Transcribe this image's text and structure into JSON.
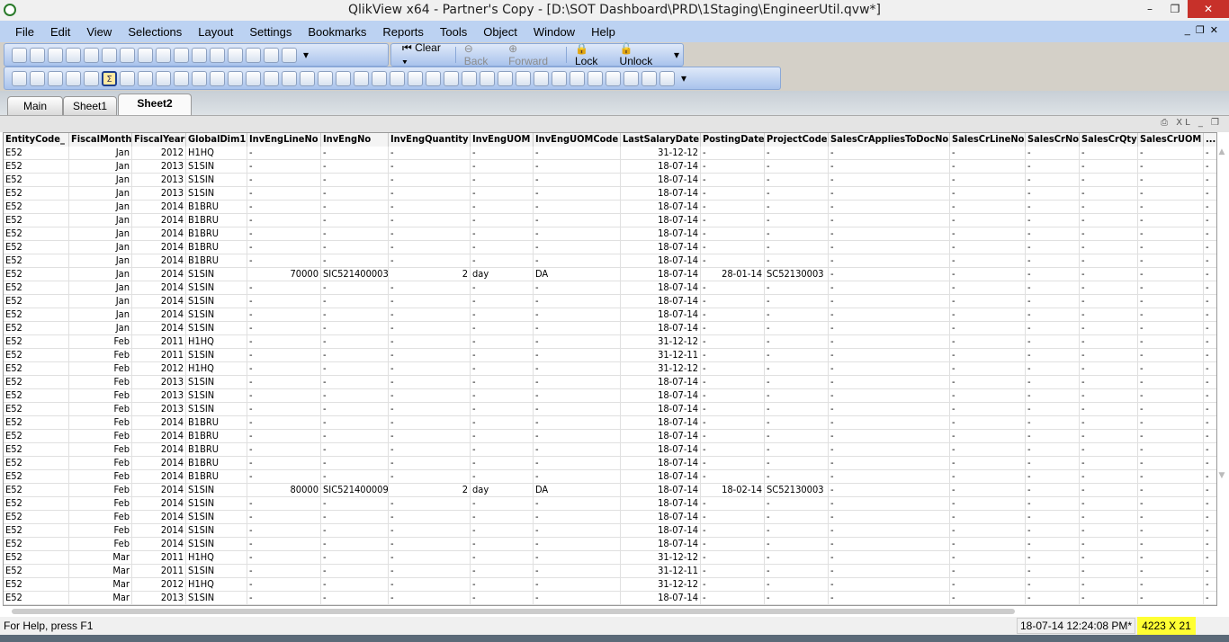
{
  "window": {
    "title": "QlikView x64 - Partner's Copy - [D:\\SOT Dashboard\\PRD\\1Staging\\EngineerUtil.qvw*]",
    "minimize": "–",
    "restore": "❐",
    "close": "✕"
  },
  "menu": [
    "File",
    "Edit",
    "View",
    "Selections",
    "Layout",
    "Settings",
    "Bookmarks",
    "Reports",
    "Tools",
    "Object",
    "Window",
    "Help"
  ],
  "toolbar1": {
    "icons": [
      "new-icon",
      "open-icon",
      "reload-icon",
      "save-icon",
      "print-icon",
      "edit-script-icon",
      "reload-data-icon",
      "undo-icon",
      "redo-icon",
      "search-icon",
      "select-icon",
      "chart-icon",
      "bookmark-star-icon",
      "properties-icon",
      "help-icon",
      "context-help-icon"
    ]
  },
  "nav": {
    "clear": "Clear",
    "back": "Back",
    "forward": "Forward",
    "lock": "Lock",
    "unlock": "Unlock"
  },
  "toolbar2": {
    "icons": [
      "new-sheet-icon",
      "promote-icon",
      "demote-icon",
      "sheet-props-icon",
      "listbox-icon",
      "statistics-box-icon",
      "multibox-icon",
      "table-box-icon",
      "chart-icon",
      "input-box-icon",
      "current-selections-icon",
      "button-icon",
      "text-object-icon",
      "line-arrow-icon",
      "slider-icon",
      "bookmark-object-icon",
      "search-object-icon",
      "container-icon",
      "custom-object-icon",
      "wizard-icon",
      "format-painter-icon",
      "grid-icon",
      "align-left-icon",
      "align-center-icon",
      "align-right-icon",
      "align-bottom-icon",
      "align-middle-icon",
      "align-top-icon",
      "space-vertical-icon",
      "space-horizontal-icon",
      "adjust-left-icon",
      "adjust-top-icon",
      "users-icon",
      "sheet-object-icon",
      "edit-object-icon",
      "link-icon",
      "document-web-icon"
    ]
  },
  "tabs": [
    {
      "label": "Main"
    },
    {
      "label": "Sheet1"
    },
    {
      "label": "Sheet2",
      "active": true
    }
  ],
  "object_caption": {
    "controls": "⎙ XL _ ❐"
  },
  "table": {
    "columns": [
      "EntityCode_",
      "FiscalMonth",
      "FiscalYear",
      "GlobalDim1",
      "InvEngLineNo",
      "InvEngNo",
      "InvEngQuantity",
      "InvEngUOM",
      "InvEngUOMCode",
      "LastSalaryDate",
      "PostingDate",
      "ProjectCode",
      "SalesCrAppliesToDocNo",
      "SalesCrLineNo",
      "SalesCrNo",
      "SalesCrQty",
      "SalesCrUOM",
      "..."
    ],
    "rows": [
      [
        "E52",
        "Jan",
        "2012",
        "H1HQ",
        "-",
        "-",
        "-",
        "-",
        "-",
        "31-12-12",
        "-",
        "-",
        "-",
        "-",
        "-",
        "-",
        "-",
        "-"
      ],
      [
        "E52",
        "Jan",
        "2013",
        "S1SIN",
        "-",
        "-",
        "-",
        "-",
        "-",
        "18-07-14",
        "-",
        "-",
        "-",
        "-",
        "-",
        "-",
        "-",
        "-"
      ],
      [
        "E52",
        "Jan",
        "2013",
        "S1SIN",
        "-",
        "-",
        "-",
        "-",
        "-",
        "18-07-14",
        "-",
        "-",
        "-",
        "-",
        "-",
        "-",
        "-",
        "-"
      ],
      [
        "E52",
        "Jan",
        "2013",
        "S1SIN",
        "-",
        "-",
        "-",
        "-",
        "-",
        "18-07-14",
        "-",
        "-",
        "-",
        "-",
        "-",
        "-",
        "-",
        "-"
      ],
      [
        "E52",
        "Jan",
        "2014",
        "B1BRU",
        "-",
        "-",
        "-",
        "-",
        "-",
        "18-07-14",
        "-",
        "-",
        "-",
        "-",
        "-",
        "-",
        "-",
        "-"
      ],
      [
        "E52",
        "Jan",
        "2014",
        "B1BRU",
        "-",
        "-",
        "-",
        "-",
        "-",
        "18-07-14",
        "-",
        "-",
        "-",
        "-",
        "-",
        "-",
        "-",
        "-"
      ],
      [
        "E52",
        "Jan",
        "2014",
        "B1BRU",
        "-",
        "-",
        "-",
        "-",
        "-",
        "18-07-14",
        "-",
        "-",
        "-",
        "-",
        "-",
        "-",
        "-",
        "-"
      ],
      [
        "E52",
        "Jan",
        "2014",
        "B1BRU",
        "-",
        "-",
        "-",
        "-",
        "-",
        "18-07-14",
        "-",
        "-",
        "-",
        "-",
        "-",
        "-",
        "-",
        "-"
      ],
      [
        "E52",
        "Jan",
        "2014",
        "B1BRU",
        "-",
        "-",
        "-",
        "-",
        "-",
        "18-07-14",
        "-",
        "-",
        "-",
        "-",
        "-",
        "-",
        "-",
        "-"
      ],
      [
        "E52",
        "Jan",
        "2014",
        "S1SIN",
        "70000",
        "SIC521400003",
        "2",
        "day",
        "DA",
        "18-07-14",
        "28-01-14",
        "SC52130003",
        "-",
        "-",
        "-",
        "-",
        "-",
        "-"
      ],
      [
        "E52",
        "Jan",
        "2014",
        "S1SIN",
        "-",
        "-",
        "-",
        "-",
        "-",
        "18-07-14",
        "-",
        "-",
        "-",
        "-",
        "-",
        "-",
        "-",
        "-"
      ],
      [
        "E52",
        "Jan",
        "2014",
        "S1SIN",
        "-",
        "-",
        "-",
        "-",
        "-",
        "18-07-14",
        "-",
        "-",
        "-",
        "-",
        "-",
        "-",
        "-",
        "-"
      ],
      [
        "E52",
        "Jan",
        "2014",
        "S1SIN",
        "-",
        "-",
        "-",
        "-",
        "-",
        "18-07-14",
        "-",
        "-",
        "-",
        "-",
        "-",
        "-",
        "-",
        "-"
      ],
      [
        "E52",
        "Jan",
        "2014",
        "S1SIN",
        "-",
        "-",
        "-",
        "-",
        "-",
        "18-07-14",
        "-",
        "-",
        "-",
        "-",
        "-",
        "-",
        "-",
        "-"
      ],
      [
        "E52",
        "Feb",
        "2011",
        "H1HQ",
        "-",
        "-",
        "-",
        "-",
        "-",
        "31-12-12",
        "-",
        "-",
        "-",
        "-",
        "-",
        "-",
        "-",
        "-"
      ],
      [
        "E52",
        "Feb",
        "2011",
        "S1SIN",
        "-",
        "-",
        "-",
        "-",
        "-",
        "31-12-11",
        "-",
        "-",
        "-",
        "-",
        "-",
        "-",
        "-",
        "-"
      ],
      [
        "E52",
        "Feb",
        "2012",
        "H1HQ",
        "-",
        "-",
        "-",
        "-",
        "-",
        "31-12-12",
        "-",
        "-",
        "-",
        "-",
        "-",
        "-",
        "-",
        "-"
      ],
      [
        "E52",
        "Feb",
        "2013",
        "S1SIN",
        "-",
        "-",
        "-",
        "-",
        "-",
        "18-07-14",
        "-",
        "-",
        "-",
        "-",
        "-",
        "-",
        "-",
        "-"
      ],
      [
        "E52",
        "Feb",
        "2013",
        "S1SIN",
        "-",
        "-",
        "-",
        "-",
        "-",
        "18-07-14",
        "-",
        "-",
        "-",
        "-",
        "-",
        "-",
        "-",
        "-"
      ],
      [
        "E52",
        "Feb",
        "2013",
        "S1SIN",
        "-",
        "-",
        "-",
        "-",
        "-",
        "18-07-14",
        "-",
        "-",
        "-",
        "-",
        "-",
        "-",
        "-",
        "-"
      ],
      [
        "E52",
        "Feb",
        "2014",
        "B1BRU",
        "-",
        "-",
        "-",
        "-",
        "-",
        "18-07-14",
        "-",
        "-",
        "-",
        "-",
        "-",
        "-",
        "-",
        "-"
      ],
      [
        "E52",
        "Feb",
        "2014",
        "B1BRU",
        "-",
        "-",
        "-",
        "-",
        "-",
        "18-07-14",
        "-",
        "-",
        "-",
        "-",
        "-",
        "-",
        "-",
        "-"
      ],
      [
        "E52",
        "Feb",
        "2014",
        "B1BRU",
        "-",
        "-",
        "-",
        "-",
        "-",
        "18-07-14",
        "-",
        "-",
        "-",
        "-",
        "-",
        "-",
        "-",
        "-"
      ],
      [
        "E52",
        "Feb",
        "2014",
        "B1BRU",
        "-",
        "-",
        "-",
        "-",
        "-",
        "18-07-14",
        "-",
        "-",
        "-",
        "-",
        "-",
        "-",
        "-",
        "-"
      ],
      [
        "E52",
        "Feb",
        "2014",
        "B1BRU",
        "-",
        "-",
        "-",
        "-",
        "-",
        "18-07-14",
        "-",
        "-",
        "-",
        "-",
        "-",
        "-",
        "-",
        "-"
      ],
      [
        "E52",
        "Feb",
        "2014",
        "S1SIN",
        "80000",
        "SIC521400009",
        "2",
        "day",
        "DA",
        "18-07-14",
        "18-02-14",
        "SC52130003",
        "-",
        "-",
        "-",
        "-",
        "-",
        "-"
      ],
      [
        "E52",
        "Feb",
        "2014",
        "S1SIN",
        "-",
        "-",
        "-",
        "-",
        "-",
        "18-07-14",
        "-",
        "-",
        "-",
        "-",
        "-",
        "-",
        "-",
        "-"
      ],
      [
        "E52",
        "Feb",
        "2014",
        "S1SIN",
        "-",
        "-",
        "-",
        "-",
        "-",
        "18-07-14",
        "-",
        "-",
        "-",
        "-",
        "-",
        "-",
        "-",
        "-"
      ],
      [
        "E52",
        "Feb",
        "2014",
        "S1SIN",
        "-",
        "-",
        "-",
        "-",
        "-",
        "18-07-14",
        "-",
        "-",
        "-",
        "-",
        "-",
        "-",
        "-",
        "-"
      ],
      [
        "E52",
        "Feb",
        "2014",
        "S1SIN",
        "-",
        "-",
        "-",
        "-",
        "-",
        "18-07-14",
        "-",
        "-",
        "-",
        "-",
        "-",
        "-",
        "-",
        "-"
      ],
      [
        "E52",
        "Mar",
        "2011",
        "H1HQ",
        "-",
        "-",
        "-",
        "-",
        "-",
        "31-12-12",
        "-",
        "-",
        "-",
        "-",
        "-",
        "-",
        "-",
        "-"
      ],
      [
        "E52",
        "Mar",
        "2011",
        "S1SIN",
        "-",
        "-",
        "-",
        "-",
        "-",
        "31-12-11",
        "-",
        "-",
        "-",
        "-",
        "-",
        "-",
        "-",
        "-"
      ],
      [
        "E52",
        "Mar",
        "2012",
        "H1HQ",
        "-",
        "-",
        "-",
        "-",
        "-",
        "31-12-12",
        "-",
        "-",
        "-",
        "-",
        "-",
        "-",
        "-",
        "-"
      ],
      [
        "E52",
        "Mar",
        "2013",
        "S1SIN",
        "-",
        "-",
        "-",
        "-",
        "-",
        "18-07-14",
        "-",
        "-",
        "-",
        "-",
        "-",
        "-",
        "-",
        "-"
      ]
    ]
  },
  "status": {
    "help": "For Help, press F1",
    "timestamp": "18-07-14 12:24:08 PM*",
    "dimensions": "4223 X 21",
    "highlight_color": "#ffff33"
  }
}
